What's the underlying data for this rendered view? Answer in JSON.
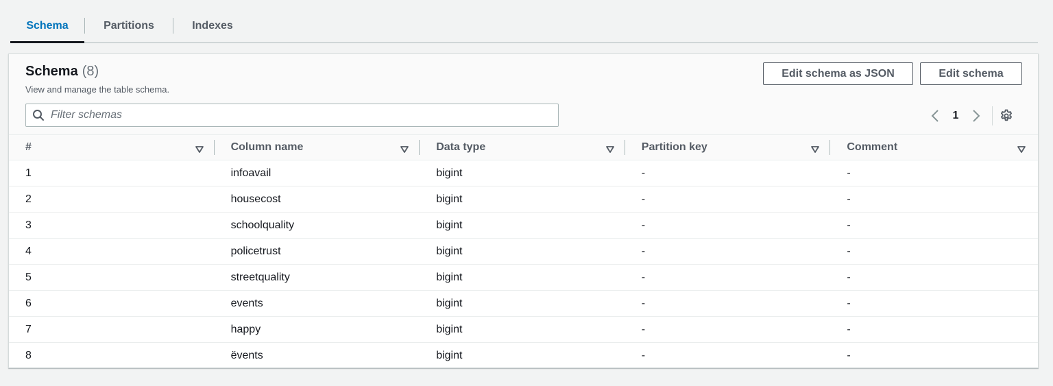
{
  "tabs": [
    {
      "label": "Schema"
    },
    {
      "label": "Partitions"
    },
    {
      "label": "Indexes"
    }
  ],
  "panel": {
    "title": "Schema",
    "count": "(8)",
    "description": "View and manage the table schema.",
    "buttons": {
      "edit_json": "Edit schema as JSON",
      "edit": "Edit schema"
    },
    "filter": {
      "placeholder": "Filter schemas",
      "value": ""
    },
    "pagination": {
      "current_page": "1"
    }
  },
  "table": {
    "columns": [
      "#",
      "Column name",
      "Data type",
      "Partition key",
      "Comment"
    ],
    "rows": [
      {
        "num": "1",
        "name": "infoavail",
        "type": "bigint",
        "partition": "-",
        "comment": "-"
      },
      {
        "num": "2",
        "name": "housecost",
        "type": "bigint",
        "partition": "-",
        "comment": "-"
      },
      {
        "num": "3",
        "name": "schoolquality",
        "type": "bigint",
        "partition": "-",
        "comment": "-"
      },
      {
        "num": "4",
        "name": "policetrust",
        "type": "bigint",
        "partition": "-",
        "comment": "-"
      },
      {
        "num": "5",
        "name": "streetquality",
        "type": "bigint",
        "partition": "-",
        "comment": "-"
      },
      {
        "num": "6",
        "name": "events",
        "type": "bigint",
        "partition": "-",
        "comment": "-"
      },
      {
        "num": "7",
        "name": "happy",
        "type": "bigint",
        "partition": "-",
        "comment": "-"
      },
      {
        "num": "8",
        "name": "ëvents",
        "type": "bigint",
        "partition": "-",
        "comment": "-"
      }
    ]
  },
  "icons": {
    "search": "search-icon",
    "prev": "chevron-left-icon",
    "next": "chevron-right-icon",
    "settings": "gear-icon",
    "sort": "sort-caret-icon"
  },
  "colors": {
    "active_tab": "#0073bb",
    "text": "#16191f",
    "secondary_text": "#545b64",
    "background": "#f2f3f3"
  }
}
